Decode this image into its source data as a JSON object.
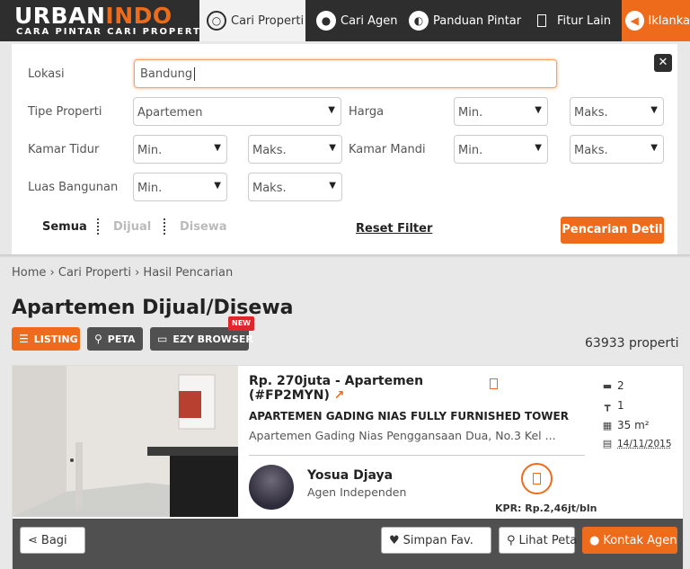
{
  "brand": {
    "logo_part1": "URB",
    "logo_mark": "A",
    "logo_part2": "N",
    "logo_part3": "INDO",
    "tagline": "CARA PINTAR CARI PROPERTI"
  },
  "nav": {
    "items": [
      {
        "label": "Cari Properti",
        "icon": "search-icon"
      },
      {
        "label": "Cari Agen",
        "icon": "user-icon"
      },
      {
        "label": "Panduan Pintar",
        "icon": "bulb-icon"
      },
      {
        "label": "Fitur Lain",
        "icon": "grid-icon"
      },
      {
        "label": "Iklanka",
        "icon": "megaphone-icon"
      }
    ]
  },
  "filter": {
    "lokasi_label": "Lokasi",
    "lokasi_value": "Bandung",
    "tipe_label": "Tipe Properti",
    "tipe_value": "Apartemen",
    "harga_label": "Harga",
    "harga_min": "Min.",
    "harga_max": "Maks.",
    "kamar_tidur_label": "Kamar Tidur",
    "kamar_tidur_min": "Min.",
    "kamar_tidur_max": "Maks.",
    "kamar_mandi_label": "Kamar Mandi",
    "kamar_mandi_min": "Min.",
    "kamar_mandi_max": "Maks.",
    "luas_label": "Luas Bangunan",
    "luas_min": "Min.",
    "luas_max": "Maks.",
    "tabs": [
      "Semua",
      "Dijual",
      "Disewa"
    ],
    "active_tab": "Semua",
    "reset_label": "Reset Filter",
    "search_label": "Pencarian Detil"
  },
  "breadcrumb": {
    "home": "Home",
    "cari": "Cari Properti",
    "hasil": "Hasil Pencarian",
    "sep": "›"
  },
  "page_title": "Apartemen Dijual/Disewa",
  "views": {
    "listing": "LISTING",
    "peta": "PETA",
    "ezy": "EZY BROWSER",
    "new_badge": "NEW"
  },
  "result_count": "63933 properti",
  "listing": {
    "price": "Rp. 270juta - Apartemen",
    "code": "(#FP2MYN)",
    "title": "APARTEMEN GADING NIAS FULLY FURNISHED TOWER",
    "address": "Apartemen Gading Nias Penggansaan Dua, No.3 Kel ...",
    "bedrooms": "2",
    "bathrooms": "1",
    "area": "35 m²",
    "date": "14/11/2015",
    "agent_name": "Yosua Djaya",
    "agent_type": "Agen Independen",
    "kpr": "KPR: Rp.2,46jt/bln"
  },
  "actions": {
    "share": "Bagi",
    "save": "Simpan Fav.",
    "map": "Lihat Peta",
    "contact": "Kontak Agen"
  },
  "colors": {
    "accent": "#ee6b1c",
    "dark": "#2e2e2e",
    "footer": "#505050",
    "badge": "#e0262d"
  }
}
